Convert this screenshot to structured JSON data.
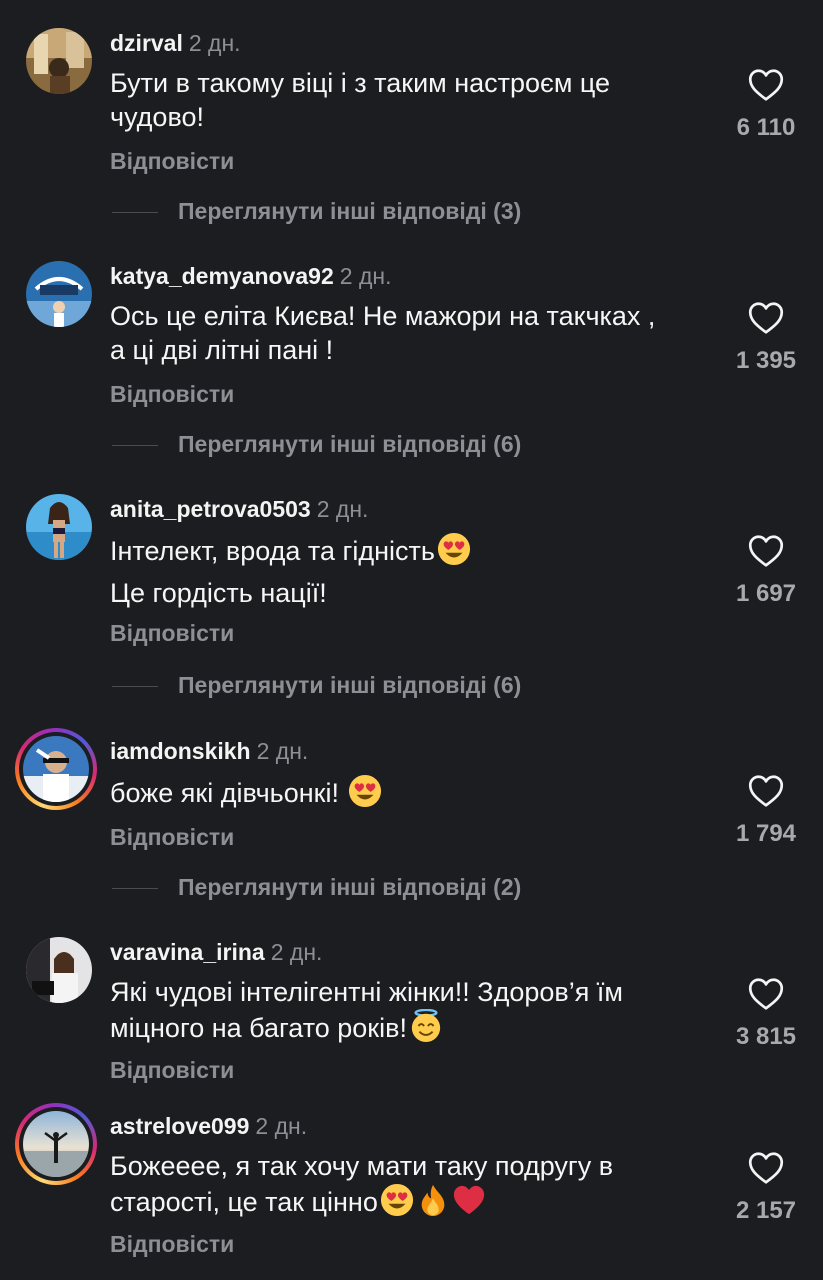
{
  "comments": [
    {
      "username": "dzirval",
      "time": "2 дн.",
      "text": "Бути в такому віці і з таким настроєм це чудово!",
      "likes": "6 110",
      "reply_label": "Відповісти",
      "more_replies": "Переглянути інші відповіді (3)"
    },
    {
      "username": "katya_demyanova92",
      "time": "2 дн.",
      "text": "Ось це еліта Києва! Не мажори на такчках , а ці дві літні пані !",
      "likes": "1 395",
      "reply_label": "Відповісти",
      "more_replies": "Переглянути інші відповіді (6)"
    },
    {
      "username": "anita_petrova0503",
      "time": "2 дн.",
      "text_line1": "Інтелект, врода та гідність",
      "text_line2": "Це гордість нації!",
      "likes": "1 697",
      "reply_label": "Відповісти",
      "more_replies": "Переглянути інші відповіді (6)"
    },
    {
      "username": "iamdonskikh",
      "time": "2 дн.",
      "text": "боже які дівчьонкі!",
      "likes": "1 794",
      "reply_label": "Відповісти",
      "more_replies": "Переглянути інші відповіді (2)"
    },
    {
      "username": "varavina_irina",
      "time": "2 дн.",
      "text": "Які чудові інтелігентні жінки!! Здоров’я їм міцного на багато років!",
      "likes": "3 815",
      "reply_label": "Відповісти"
    },
    {
      "username": "astrelove099",
      "time": "2 дн.",
      "text": "Божееее, я так хочу мати таку подругу в старості, це так цінно",
      "likes": "2 157",
      "reply_label": "Відповісти"
    }
  ],
  "icons": {
    "like": "heart-outline-icon",
    "emoji_heart_eyes": "heart-eyes-emoji",
    "emoji_halo": "smiling-face-with-halo-emoji",
    "emoji_fire": "fire-emoji",
    "emoji_red_heart": "red-heart-emoji"
  },
  "colors": {
    "background": "#1c1d21",
    "text": "#f4f4f4",
    "muted": "#8e8f94",
    "story_ring": "#d62976"
  }
}
